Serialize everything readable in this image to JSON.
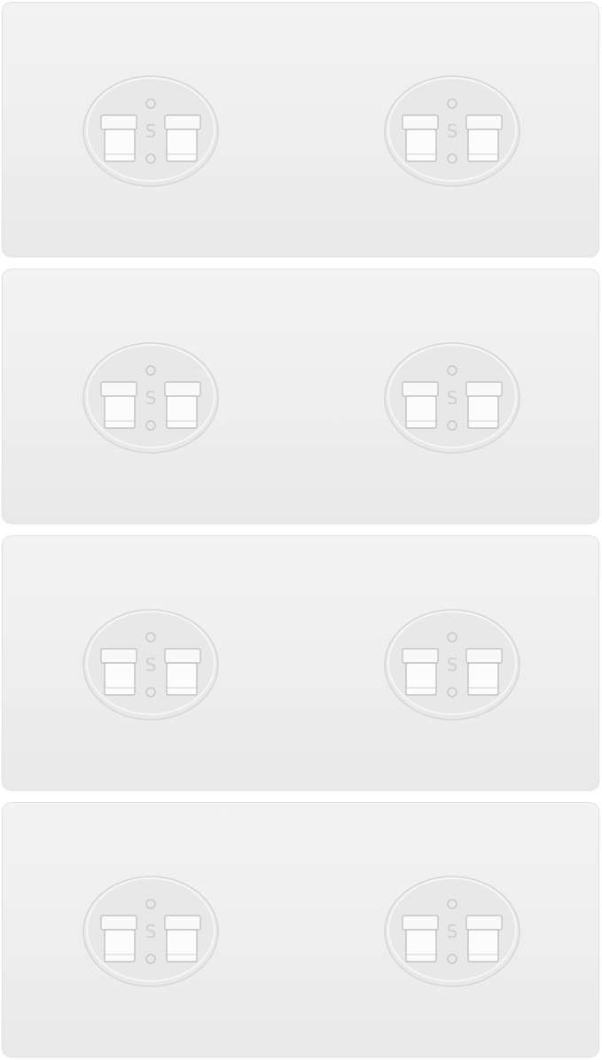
{
  "image": {
    "subject": "adhesive-wall-mount-plates",
    "plates": [
      {
        "hooks": [
          {
            "letter": "S"
          },
          {
            "letter": "S"
          }
        ]
      },
      {
        "hooks": [
          {
            "letter": "S"
          },
          {
            "letter": "S"
          }
        ]
      },
      {
        "hooks": [
          {
            "letter": "S"
          },
          {
            "letter": "S"
          }
        ]
      },
      {
        "hooks": [
          {
            "letter": "S"
          },
          {
            "letter": "S"
          }
        ]
      }
    ],
    "colors": {
      "background": "#ffffff",
      "plate": "#eeeeee",
      "hook-base": "#e6e6e6",
      "clip": "#fafafa"
    }
  }
}
